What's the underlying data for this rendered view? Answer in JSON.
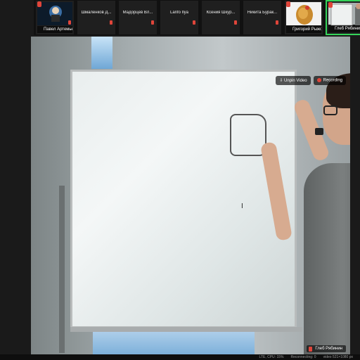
{
  "participants": [
    {
      "name": "Павел Артемьев",
      "type": "avatar"
    },
    {
      "name": "Шмаленков Д...",
      "type": "label"
    },
    {
      "name": "Мадорцев Вл...",
      "type": "label"
    },
    {
      "name": "Lanfo Ilya",
      "type": "label"
    },
    {
      "name": "Ксения Шкур...",
      "type": "label"
    },
    {
      "name": "Никита Бурак...",
      "type": "label"
    },
    {
      "name": "Григорий Рыжов",
      "type": "photo"
    },
    {
      "name": "Глеб Рябинин",
      "type": "video"
    }
  ],
  "main_video": {
    "speaker_name": "Глеб Рябинин",
    "recording_label": "Recording",
    "unpin_label": "Unpin Video"
  },
  "status_bar": {
    "text_1": "video 521×1080 px",
    "text_2": "Reconnecting: 0",
    "text_3": "LTE, CPU: 15%"
  },
  "colors": {
    "active_border": "#35d35a",
    "muted_red": "#e0453a"
  }
}
